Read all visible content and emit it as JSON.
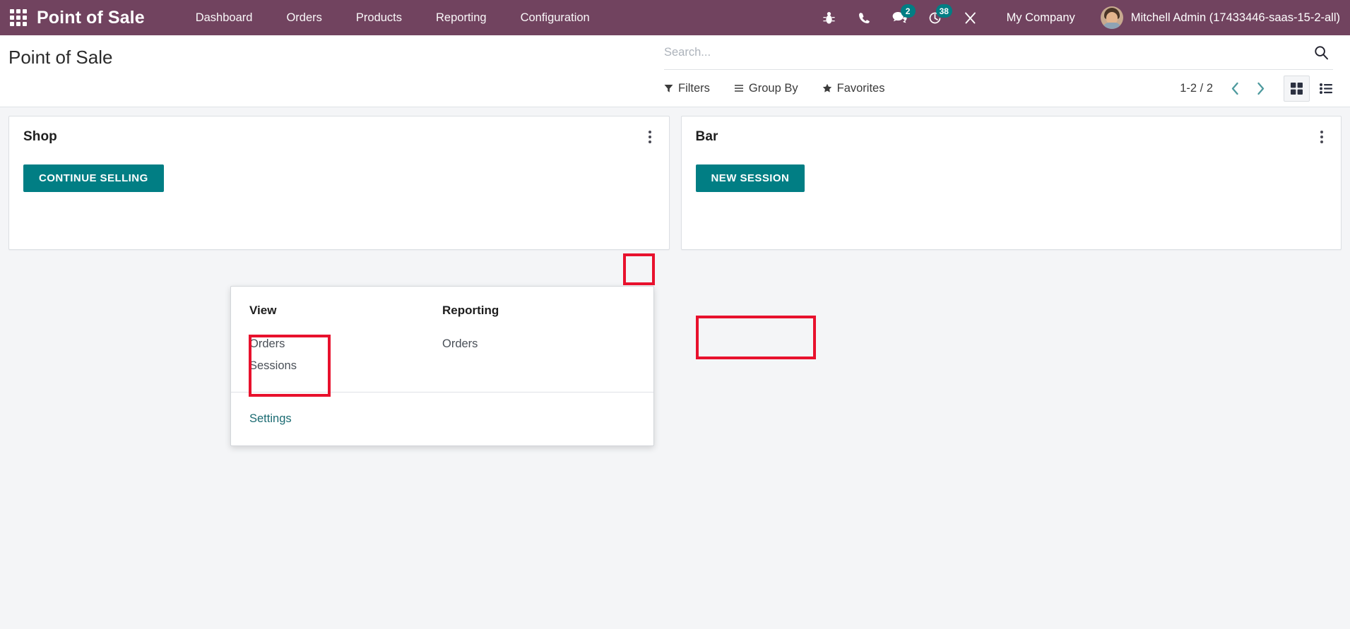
{
  "navbar": {
    "apps_icon": "apps-grid-icon",
    "brand": "Point of Sale",
    "menu": [
      {
        "label": "Dashboard"
      },
      {
        "label": "Orders"
      },
      {
        "label": "Products"
      },
      {
        "label": "Reporting"
      },
      {
        "label": "Configuration"
      }
    ],
    "icons": [
      {
        "name": "bug-icon",
        "badge": null
      },
      {
        "name": "phone-icon",
        "badge": null
      },
      {
        "name": "messages-icon",
        "badge": "2"
      },
      {
        "name": "activities-clock-icon",
        "badge": "38"
      },
      {
        "name": "tools-wrench-icon",
        "badge": null
      }
    ],
    "company": "My Company",
    "user": "Mitchell Admin (17433446-saas-15-2-all)",
    "accent_purple": "#71435f",
    "badge_color": "#017e84"
  },
  "control_panel": {
    "page_title": "Point of Sale",
    "search": {
      "placeholder": "Search...",
      "value": "",
      "icon": "search-icon"
    },
    "tools": [
      {
        "label": "Filters",
        "icon": "filter-icon"
      },
      {
        "label": "Group By",
        "icon": "hamburger-icon"
      },
      {
        "label": "Favorites",
        "icon": "star-icon"
      }
    ],
    "pager": {
      "count": "1-2 / 2",
      "prev_icon": "chevron-left-icon",
      "next_icon": "chevron-right-icon"
    },
    "view_switcher": [
      {
        "name": "kanban-view",
        "icon": "grid-icon",
        "active": true
      },
      {
        "name": "list-view",
        "icon": "list-icon",
        "active": false
      }
    ]
  },
  "cards": [
    {
      "title": "Shop",
      "button": "CONTINUE SELLING",
      "menu_icon": "vertical-dots-icon"
    },
    {
      "title": "Bar",
      "button": "NEW SESSION",
      "menu_icon": "vertical-dots-icon"
    }
  ],
  "dropdown": {
    "columns": [
      {
        "heading": "View",
        "items": [
          {
            "label": "Orders"
          },
          {
            "label": "Sessions"
          }
        ]
      },
      {
        "heading": "Reporting",
        "items": [
          {
            "label": "Orders"
          }
        ]
      }
    ],
    "footer": {
      "label": "Settings"
    }
  },
  "annotations": {
    "color": "#e8112d",
    "boxes": [
      {
        "name": "shop-card-menu-highlight"
      },
      {
        "name": "view-orders-sessions-highlight"
      },
      {
        "name": "new-session-button-highlight"
      }
    ]
  }
}
